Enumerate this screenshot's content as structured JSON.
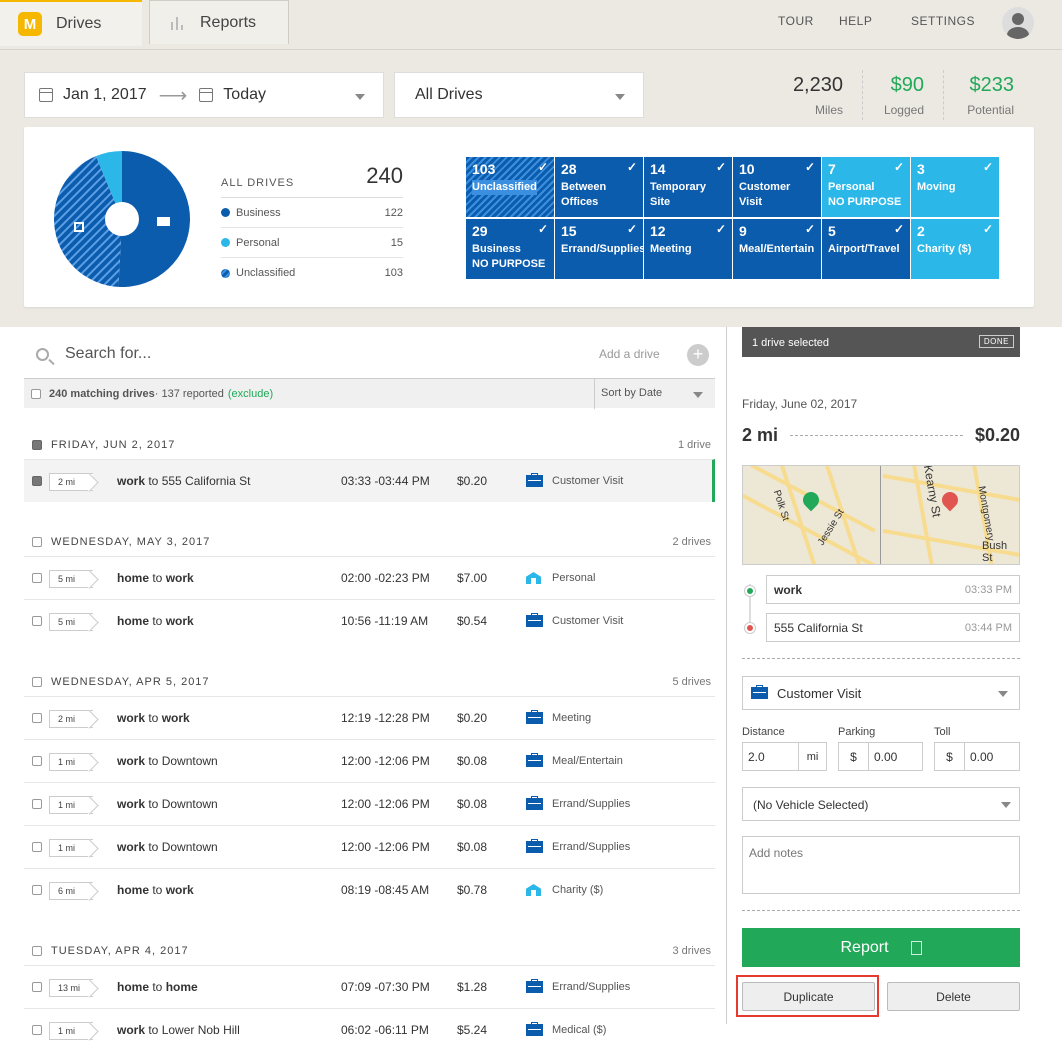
{
  "tabs": {
    "drives": "Drives",
    "reports": "Reports"
  },
  "nav": {
    "tour": "TOUR",
    "help": "HELP",
    "settings": "SETTINGS"
  },
  "filters": {
    "from": "Jan 1, 2017",
    "to": "Today",
    "drive_filter": "All Drives"
  },
  "stats": [
    {
      "value": "2,230",
      "label": "Miles"
    },
    {
      "value": "$90",
      "label": "Logged"
    },
    {
      "value": "$233",
      "label": "Potential"
    }
  ],
  "summary": {
    "title": "ALL DRIVES",
    "total": "240",
    "legend": [
      {
        "label": "Business",
        "count": "122",
        "color": "#0b5cad"
      },
      {
        "label": "Personal",
        "count": "15",
        "color": "#2bb8e8"
      },
      {
        "label": "Unclassified",
        "count": "103",
        "color": "#0b5cad"
      }
    ]
  },
  "tiles": [
    {
      "num": "103",
      "l1": "Unclassified",
      "l2": "",
      "style": "hatch"
    },
    {
      "num": "28",
      "l1": "Between",
      "l2": "Offices",
      "style": "dark"
    },
    {
      "num": "14",
      "l1": "Temporary",
      "l2": "Site",
      "style": "dark"
    },
    {
      "num": "10",
      "l1": "Customer",
      "l2": "Visit",
      "style": "dark"
    },
    {
      "num": "7",
      "l1": "Personal",
      "l2": "NO PURPOSE",
      "style": "light"
    },
    {
      "num": "3",
      "l1": "Moving",
      "l2": "",
      "style": "light"
    },
    {
      "num": "29",
      "l1": "Business",
      "l2": "NO PURPOSE",
      "style": "dark"
    },
    {
      "num": "15",
      "l1": "Errand/Supplies",
      "l2": "",
      "style": "dark"
    },
    {
      "num": "12",
      "l1": "Meeting",
      "l2": "",
      "style": "dark"
    },
    {
      "num": "9",
      "l1": "Meal/Entertain",
      "l2": "",
      "style": "dark"
    },
    {
      "num": "5",
      "l1": "Airport/Travel",
      "l2": "",
      "style": "dark"
    },
    {
      "num": "2",
      "l1": "Charity ($)",
      "l2": "",
      "style": "light"
    }
  ],
  "list": {
    "search_placeholder": "Search for...",
    "add_drive": "Add a drive",
    "matching": "240 matching drives",
    "reported": " · 137 reported ",
    "exclude": "(exclude)",
    "sort": "Sort by Date"
  },
  "groups": [
    {
      "date": "FRIDAY, JUN 2, 2017",
      "count": "1 drive",
      "drives": [
        {
          "mi": "2 mi",
          "from": "work",
          "to": "555 California St",
          "time": "03:33 -03:44 PM",
          "price": "$0.20",
          "cat": "Customer Visit",
          "icon": "briefcase",
          "selected": true
        }
      ]
    },
    {
      "date": "WEDNESDAY, MAY 3, 2017",
      "count": "2 drives",
      "drives": [
        {
          "mi": "5 mi",
          "from": "home",
          "to": "work",
          "time": "02:00 -02:23 PM",
          "price": "$7.00",
          "cat": "Personal",
          "icon": "house",
          "to_bold": true
        },
        {
          "mi": "5 mi",
          "from": "home",
          "to": "work",
          "time": "10:56 -11:19 AM",
          "price": "$0.54",
          "cat": "Customer Visit",
          "icon": "briefcase",
          "to_bold": true
        }
      ]
    },
    {
      "date": "WEDNESDAY, APR 5, 2017",
      "count": "5 drives",
      "drives": [
        {
          "mi": "2 mi",
          "from": "work",
          "to": "work",
          "time": "12:19 -12:28 PM",
          "price": "$0.20",
          "cat": "Meeting",
          "icon": "briefcase",
          "to_bold": true
        },
        {
          "mi": "1 mi",
          "from": "work",
          "to": "Downtown",
          "time": "12:00 -12:06 PM",
          "price": "$0.08",
          "cat": "Meal/Entertain",
          "icon": "briefcase"
        },
        {
          "mi": "1 mi",
          "from": "work",
          "to": "Downtown",
          "time": "12:00 -12:06 PM",
          "price": "$0.08",
          "cat": "Errand/Supplies",
          "icon": "briefcase"
        },
        {
          "mi": "1 mi",
          "from": "work",
          "to": "Downtown",
          "time": "12:00 -12:06 PM",
          "price": "$0.08",
          "cat": "Errand/Supplies",
          "icon": "briefcase"
        },
        {
          "mi": "6 mi",
          "from": "home",
          "to": "work",
          "time": "08:19 -08:45 AM",
          "price": "$0.78",
          "cat": "Charity ($)",
          "icon": "house",
          "to_bold": true
        }
      ]
    },
    {
      "date": "TUESDAY, APR 4, 2017",
      "count": "3 drives",
      "drives": [
        {
          "mi": "13 mi",
          "from": "home",
          "to": "home",
          "time": "07:09 -07:30 PM",
          "price": "$1.28",
          "cat": "Errand/Supplies",
          "icon": "briefcase",
          "to_bold": true
        },
        {
          "mi": "1 mi",
          "from": "work",
          "to": "Lower Nob Hill",
          "time": "06:02 -06:11 PM",
          "price": "$5.24",
          "cat": "Medical ($)",
          "icon": "briefcase"
        }
      ]
    }
  ],
  "panel": {
    "selected": "1 drive selected",
    "done": "DONE",
    "date": "Friday, June 02, 2017",
    "distance": "2 mi",
    "value": "$0.20",
    "map_labels": [
      "Polk St",
      "Jessie St",
      "Kearny St",
      "Montgomery",
      "Bush St"
    ],
    "start": {
      "name": "work",
      "time": "03:33 PM"
    },
    "end": {
      "name": "555 California St",
      "time": "03:44 PM"
    },
    "category": "Customer Visit",
    "distance_label": "Distance",
    "distance_value": "2.0",
    "distance_unit": "mi",
    "parking_label": "Parking",
    "parking_value": "0.00",
    "toll_label": "Toll",
    "toll_value": "0.00",
    "currency": "$",
    "vehicle": "(No Vehicle Selected)",
    "notes_placeholder": "Add notes",
    "report": "Report",
    "duplicate": "Duplicate",
    "delete": "Delete"
  },
  "pie_data": {
    "business": 122,
    "personal": 15,
    "unclassified": 103
  }
}
